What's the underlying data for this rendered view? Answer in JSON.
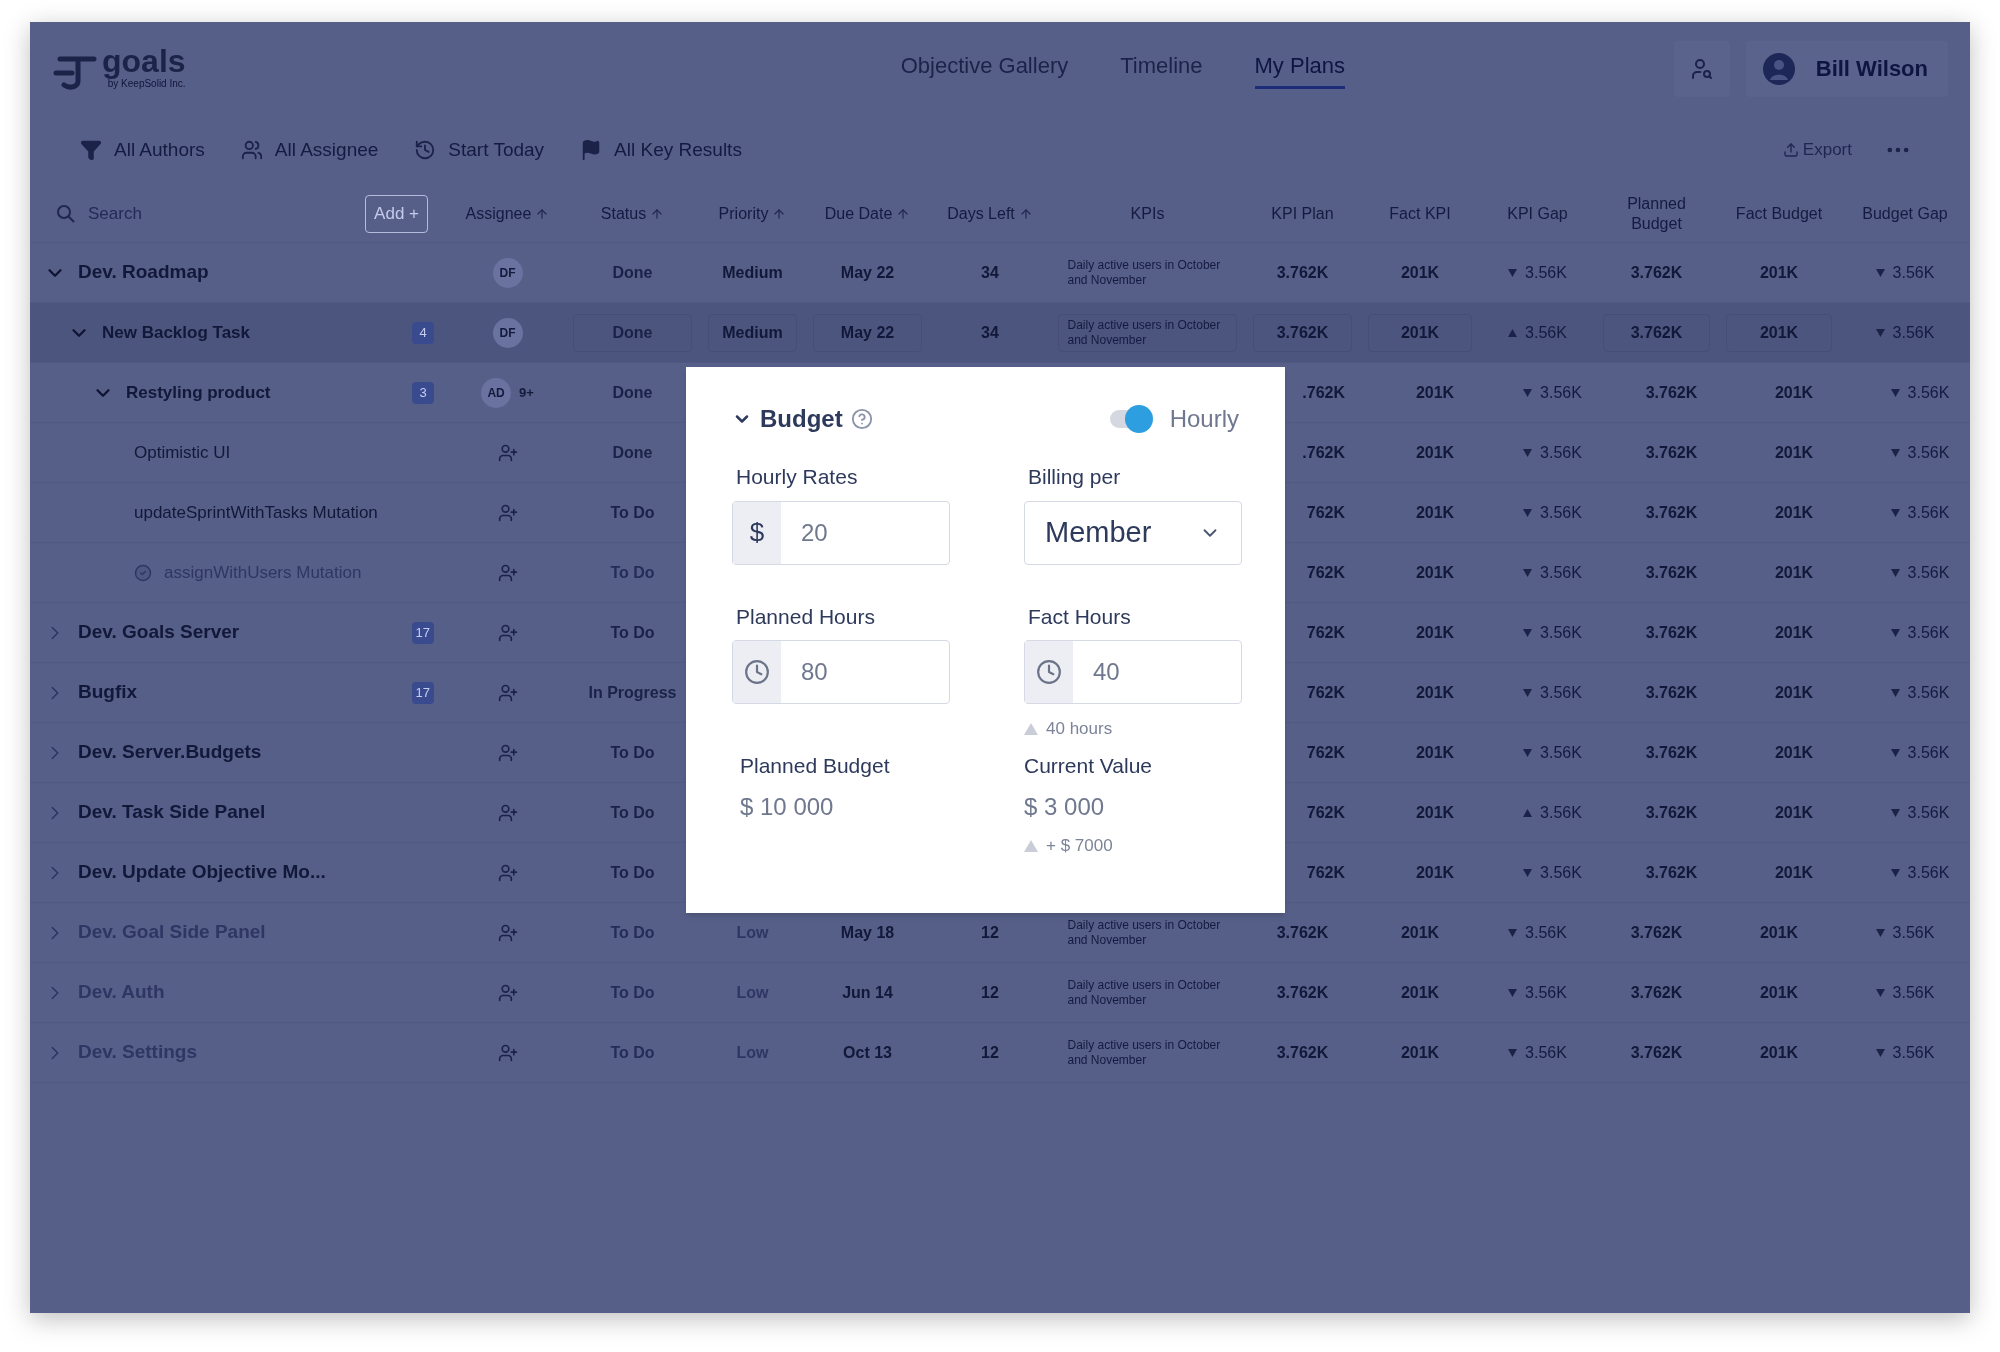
{
  "logo": {
    "name": "goals",
    "tagline": "by KeepSolid Inc."
  },
  "nav_tabs": [
    {
      "label": "Objective Gallery",
      "selected": false
    },
    {
      "label": "Timeline",
      "selected": false
    },
    {
      "label": "My Plans",
      "selected": true
    }
  ],
  "user": {
    "name": "Bill Wilson"
  },
  "filters": [
    {
      "kind": "filter",
      "label": "All Authors"
    },
    {
      "kind": "people",
      "label": "All Assignee"
    },
    {
      "kind": "history",
      "label": "Start Today"
    },
    {
      "kind": "flag",
      "label": "All Key Results"
    }
  ],
  "export": {
    "label": "Export"
  },
  "search": {
    "placeholder": "Search"
  },
  "add_button": {
    "label": "Add +"
  },
  "columns": [
    {
      "label": "Assignee",
      "sortable": true
    },
    {
      "label": "Status",
      "sortable": true
    },
    {
      "label": "Priority",
      "sortable": true
    },
    {
      "label": "Due Date",
      "sortable": true
    },
    {
      "label": "Days Left",
      "sortable": true
    },
    {
      "label": "KPIs",
      "sortable": false
    },
    {
      "label": "KPI Plan",
      "sortable": false
    },
    {
      "label": "Fact KPI",
      "sortable": false
    },
    {
      "label": "KPI Gap",
      "sortable": false
    },
    {
      "label": "Planned Budget",
      "sortable": false
    },
    {
      "label": "Fact Budget",
      "sortable": false
    },
    {
      "label": "Budget Gap",
      "sortable": false
    }
  ],
  "rows": [
    {
      "name": "Dev. Roadmap",
      "expanded": true,
      "selected": false,
      "faded": false,
      "done": false,
      "assignee": {
        "kind": "initials",
        "text": "DF"
      },
      "status": "Done",
      "priority": "Medium",
      "due": "May 22",
      "days_left": "34",
      "kpis": "Daily active users in October and November",
      "kpi_plan": "3.762K",
      "fact_kpi": "201K",
      "kpi_gap": {
        "up": false,
        "value": "3.56K"
      },
      "planned_budget": "3.762K",
      "fact_budget": "201K",
      "budget_gap": {
        "up": false,
        "value": "3.56K"
      },
      "children": [
        {
          "name": "New Backlog Task",
          "count": "4",
          "expanded": true,
          "selected": true,
          "faded": false,
          "done": false,
          "assignee": {
            "kind": "initials",
            "text": "DF"
          },
          "status": "Done",
          "priority": "Medium",
          "due": "May 22",
          "days_left": "34",
          "kpis": "Daily active users in October and November",
          "kpi_plan": "3.762K",
          "fact_kpi": "201K",
          "kpi_gap": {
            "up": true,
            "value": "3.56K"
          },
          "planned_budget": "3.762K",
          "fact_budget": "201K",
          "budget_gap": {
            "up": false,
            "value": "3.56K"
          },
          "children": [
            {
              "name": "Restyling product",
              "count": "3",
              "expanded": true,
              "selected": false,
              "faded": false,
              "done": false,
              "assignee": {
                "kind": "multi",
                "text": "AD",
                "extra": "9+"
              },
              "status": "Done",
              "kpi_plan": ".762K",
              "fact_kpi": "201K",
              "kpi_gap": {
                "up": false,
                "value": "3.56K"
              },
              "planned_budget": "3.762K",
              "fact_budget": "201K",
              "budget_gap": {
                "up": false,
                "value": "3.56K"
              },
              "children": [
                {
                  "name": "Optimistic UI",
                  "selected": false,
                  "faded": false,
                  "done": false,
                  "assignee": {
                    "kind": "add"
                  },
                  "status": "Done",
                  "kpi_plan": ".762K",
                  "fact_kpi": "201K",
                  "kpi_gap": {
                    "up": false,
                    "value": "3.56K"
                  },
                  "planned_budget": "3.762K",
                  "fact_budget": "201K",
                  "budget_gap": {
                    "up": false,
                    "value": "3.56K"
                  }
                },
                {
                  "name": "updateSprintWithTasks Mutation",
                  "selected": false,
                  "faded": false,
                  "done": false,
                  "assignee": {
                    "kind": "add"
                  },
                  "status": "To Do",
                  "kpi_plan": "762K",
                  "fact_kpi": "201K",
                  "kpi_gap": {
                    "up": false,
                    "value": "3.56K"
                  },
                  "planned_budget": "3.762K",
                  "fact_budget": "201K",
                  "budget_gap": {
                    "up": false,
                    "value": "3.56K"
                  }
                },
                {
                  "name": "assignWithUsers Mutation",
                  "selected": false,
                  "faded": true,
                  "done": true,
                  "assignee": {
                    "kind": "add"
                  },
                  "status": "To Do",
                  "kpi_plan": "762K",
                  "fact_kpi": "201K",
                  "kpi_gap": {
                    "up": false,
                    "value": "3.56K"
                  },
                  "planned_budget": "3.762K",
                  "fact_budget": "201K",
                  "budget_gap": {
                    "up": false,
                    "value": "3.56K"
                  }
                }
              ]
            }
          ]
        }
      ]
    },
    {
      "name": "Dev. Goals Server",
      "count": "17",
      "expanded": false,
      "selected": false,
      "faded": false,
      "done": false,
      "assignee": {
        "kind": "add"
      },
      "status": "To Do",
      "kpi_plan": "762K",
      "fact_kpi": "201K",
      "kpi_gap": {
        "up": false,
        "value": "3.56K"
      },
      "planned_budget": "3.762K",
      "fact_budget": "201K",
      "budget_gap": {
        "up": false,
        "value": "3.56K"
      }
    },
    {
      "name": "Bugfix",
      "count": "17",
      "expanded": false,
      "selected": false,
      "faded": false,
      "done": false,
      "assignee": {
        "kind": "add"
      },
      "status": "In Progress",
      "kpi_plan": "762K",
      "fact_kpi": "201K",
      "kpi_gap": {
        "up": false,
        "value": "3.56K"
      },
      "planned_budget": "3.762K",
      "fact_budget": "201K",
      "budget_gap": {
        "up": false,
        "value": "3.56K"
      }
    },
    {
      "name": "Dev. Server.Budgets",
      "expanded": false,
      "selected": false,
      "faded": false,
      "done": false,
      "assignee": {
        "kind": "add"
      },
      "status": "To Do",
      "kpi_plan": "762K",
      "fact_kpi": "201K",
      "kpi_gap": {
        "up": false,
        "value": "3.56K"
      },
      "planned_budget": "3.762K",
      "fact_budget": "201K",
      "budget_gap": {
        "up": false,
        "value": "3.56K"
      }
    },
    {
      "name": "Dev. Task Side Panel",
      "expanded": false,
      "selected": false,
      "faded": false,
      "done": false,
      "assignee": {
        "kind": "add"
      },
      "status": "To Do",
      "kpi_plan": "762K",
      "fact_kpi": "201K",
      "kpi_gap": {
        "up": true,
        "value": "3.56K"
      },
      "planned_budget": "3.762K",
      "fact_budget": "201K",
      "budget_gap": {
        "up": false,
        "value": "3.56K"
      }
    },
    {
      "name": "Dev. Update Objective Mo...",
      "expanded": false,
      "selected": false,
      "faded": false,
      "done": false,
      "assignee": {
        "kind": "add"
      },
      "status": "To Do",
      "kpi_plan": "762K",
      "fact_kpi": "201K",
      "kpi_gap": {
        "up": false,
        "value": "3.56K"
      },
      "planned_budget": "3.762K",
      "fact_budget": "201K",
      "budget_gap": {
        "up": false,
        "value": "3.56K"
      }
    },
    {
      "name": "Dev. Goal Side Panel",
      "expanded": false,
      "selected": false,
      "faded": true,
      "done": false,
      "assignee": {
        "kind": "add"
      },
      "status": "To Do",
      "priority": "Low",
      "due": "May 18",
      "days_left": "12",
      "kpis": "Daily active users in October and November",
      "kpi_plan": "3.762K",
      "fact_kpi": "201K",
      "kpi_gap": {
        "up": false,
        "value": "3.56K"
      },
      "planned_budget": "3.762K",
      "fact_budget": "201K",
      "budget_gap": {
        "up": false,
        "value": "3.56K"
      }
    },
    {
      "name": "Dev. Auth",
      "expanded": false,
      "selected": false,
      "faded": true,
      "done": false,
      "assignee": {
        "kind": "add"
      },
      "status": "To Do",
      "priority": "Low",
      "due": "Jun 14",
      "days_left": "12",
      "kpis": "Daily active users in October and November",
      "kpi_plan": "3.762K",
      "fact_kpi": "201K",
      "kpi_gap": {
        "up": false,
        "value": "3.56K"
      },
      "planned_budget": "3.762K",
      "fact_budget": "201K",
      "budget_gap": {
        "up": false,
        "value": "3.56K"
      }
    },
    {
      "name": "Dev. Settings",
      "expanded": false,
      "selected": false,
      "faded": true,
      "done": false,
      "assignee": {
        "kind": "add"
      },
      "status": "To Do",
      "priority": "Low",
      "due": "Oct 13",
      "days_left": "12",
      "kpis": "Daily active users in October and November",
      "kpi_plan": "3.762K",
      "fact_kpi": "201K",
      "kpi_gap": {
        "up": false,
        "value": "3.56K"
      },
      "planned_budget": "3.762K",
      "fact_budget": "201K",
      "budget_gap": {
        "up": false,
        "value": "3.56K"
      }
    }
  ],
  "budget_popup": {
    "title": "Budget",
    "expanded": true,
    "toggle": {
      "label": "Hourly",
      "on": true
    },
    "fields": [
      {
        "label": "Hourly Rates",
        "kind": "prefixed",
        "prefix": "$",
        "value": "20"
      },
      {
        "label": "Billing per",
        "kind": "select",
        "value": "Member"
      },
      {
        "label": "Planned Hours",
        "kind": "clock",
        "value": "80"
      },
      {
        "label": "Fact Hours",
        "kind": "clock",
        "value": "40",
        "hint": "40 hours"
      }
    ],
    "totals": [
      {
        "label": "Planned Budget",
        "value": "$ 10 000"
      },
      {
        "label": "Current Value",
        "value": "$ 3 000",
        "hint": "+ $ 7000"
      }
    ]
  }
}
